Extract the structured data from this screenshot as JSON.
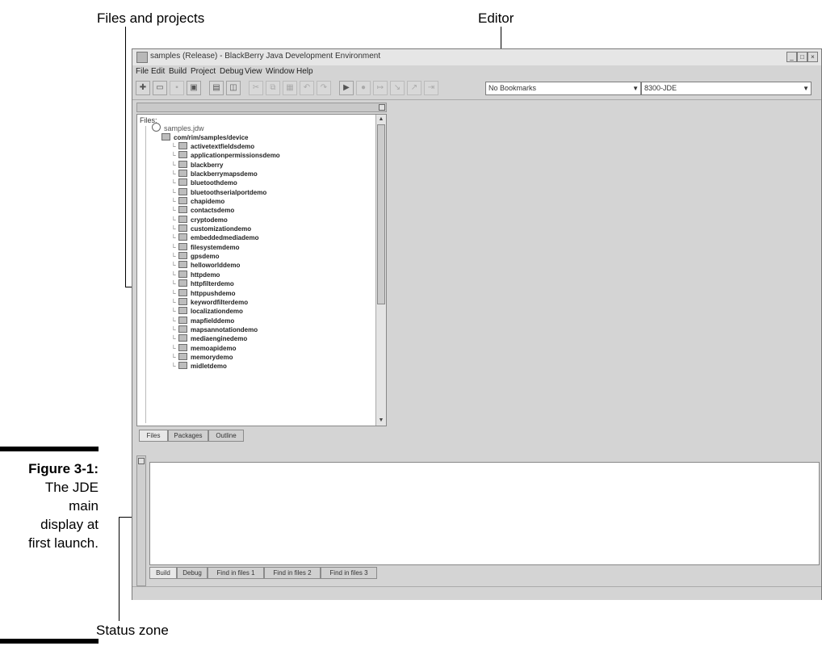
{
  "callouts": {
    "files_and_projects": "Files and projects",
    "editor": "Editor",
    "status_zone": "Status zone"
  },
  "caption": {
    "label": "Figure 3-1:",
    "lines": [
      "The JDE",
      "main",
      "display at",
      "first launch."
    ]
  },
  "window": {
    "title": "samples (Release) - BlackBerry Java Development Environment",
    "controls": [
      "minimize",
      "maximize",
      "close"
    ]
  },
  "menu": [
    "File",
    "Edit",
    "Build",
    "Project",
    "Debug",
    "View",
    "Window",
    "Help"
  ],
  "toolbar": {
    "bookmarks_value": "No Bookmarks",
    "device_value": "8300-JDE"
  },
  "files_pane": {
    "label": "Files:",
    "root": "samples.jdw",
    "package": "com/rim/samples/device",
    "items": [
      "activetextfieldsdemo",
      "applicationpermissionsdemo",
      "blackberry",
      "blackberrymapsdemo",
      "bluetoothdemo",
      "bluetoothserialportdemo",
      "chapidemo",
      "contactsdemo",
      "cryptodemo",
      "customizationdemo",
      "embeddedmediademo",
      "filesystemdemo",
      "gpsdemo",
      "helloworlddemo",
      "httpdemo",
      "httpfilterdemo",
      "httppushdemo",
      "keywordfilterdemo",
      "localizationdemo",
      "mapfielddemo",
      "mapsannotationdemo",
      "mediaenginedemo",
      "memoapidemo",
      "memorydemo",
      "midletdemo"
    ],
    "tabs": [
      "Files",
      "Packages",
      "Outline"
    ]
  },
  "output_pane": {
    "tabs": [
      "Build",
      "Debug",
      "Find in files 1",
      "Find in files 2",
      "Find in files 3"
    ]
  },
  "colors": {
    "chrome": "#d4d4d4",
    "editor_bg": "#d4d4d4",
    "output_bg": "#ffffff"
  }
}
